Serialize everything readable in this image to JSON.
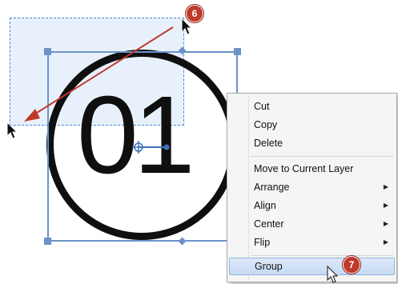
{
  "canvas": {
    "object_text": "01"
  },
  "context_menu": {
    "items": [
      {
        "label": "Cut"
      },
      {
        "label": "Copy"
      },
      {
        "label": "Delete"
      },
      {
        "label": "Move to Current Layer"
      },
      {
        "label": "Arrange",
        "submenu_arrow": "▶"
      },
      {
        "label": "Align",
        "submenu_arrow": "▶"
      },
      {
        "label": "Center",
        "submenu_arrow": "▶"
      },
      {
        "label": "Flip",
        "submenu_arrow": "▶"
      },
      {
        "label": "Group"
      }
    ]
  },
  "step_badges": {
    "first": "6",
    "second": "7"
  },
  "colors": {
    "selection_blue": "#6b93c9",
    "drag_arrow_red": "#c0392b",
    "badge_red": "#c0392b"
  },
  "icons": [
    "mouse-pointer-icon",
    "drag-arrow-icon",
    "submenu-arrow-icon"
  ]
}
